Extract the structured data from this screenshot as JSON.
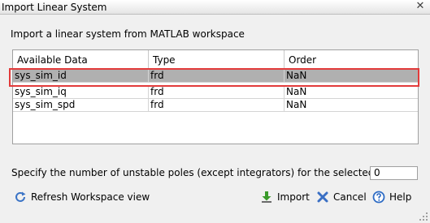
{
  "window": {
    "title": "Import Linear System",
    "close_glyph": "✕"
  },
  "prompt": "Import a linear system from MATLAB workspace",
  "table": {
    "columns": [
      "Available Data",
      "Type",
      "Order"
    ],
    "rows": [
      {
        "name": "sys_sim_id",
        "type": "frd",
        "order": "NaN",
        "selected": true
      },
      {
        "name": "sys_sim_iq",
        "type": "frd",
        "order": "NaN",
        "selected": false
      },
      {
        "name": "sys_sim_spd",
        "type": "frd",
        "order": "NaN",
        "selected": false
      }
    ]
  },
  "unstable_poles": {
    "label": "Specify the number of unstable poles (except integrators) for the selected plant:",
    "value": "0"
  },
  "buttons": {
    "refresh": "Refresh Workspace view",
    "import": "Import",
    "cancel": "Cancel",
    "help": "Help"
  },
  "icons": {
    "refresh": "refresh-icon",
    "import": "import-arrow-icon",
    "cancel": "cancel-x-icon",
    "help": "help-icon"
  },
  "colors": {
    "selection": "#b0b0b0",
    "highlight_box": "#e23b3b",
    "import_arrow": "#3a9a2a",
    "cancel_x": "#3a6fc4",
    "help_ring": "#2d6bc4"
  }
}
